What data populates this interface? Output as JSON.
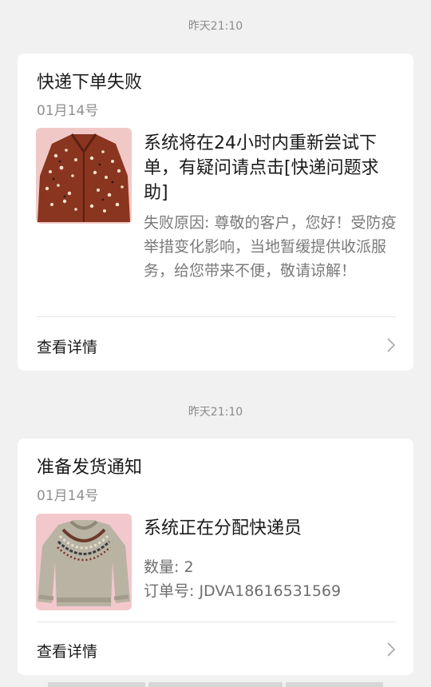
{
  "messages": [
    {
      "time": "昨天21:10",
      "title": "快递下单失败",
      "date": "01月14号",
      "headline": "系统将在24小时内重新尝试下单，有疑问请点击[快递问题求助]",
      "detail": "失败原因: 尊敬的客户，您好！受防疫举措变化影响，当地暂缓提供收派服务，给您带来不便，敬请谅解！",
      "action_label": "查看详情",
      "image": "brown-patterned-shirt"
    },
    {
      "time": "昨天21:10",
      "title": "准备发货通知",
      "date": "01月14号",
      "headline": "系统正在分配快递员",
      "quantity": "数量: 2",
      "order_number": "订单号: JDVA18616531569",
      "action_label": "查看详情",
      "image": "fair-isle-knit-sweater"
    }
  ],
  "colors": {
    "background": "#f1f1f1",
    "card": "#ffffff",
    "text_primary": "#1a1a1a",
    "text_secondary": "#8e8e8e"
  }
}
